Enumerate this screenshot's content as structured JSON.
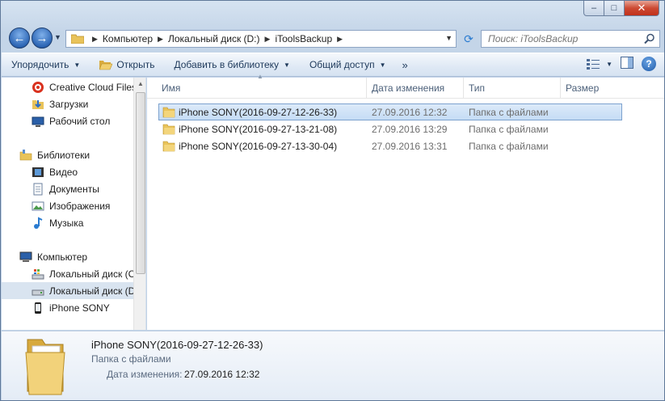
{
  "window": {
    "min_label": "‒",
    "max_label": "□",
    "close_label": "✕"
  },
  "address": {
    "crumbs": [
      "Компьютер",
      "Локальный диск (D:)",
      "iToolsBackup"
    ]
  },
  "search": {
    "placeholder": "Поиск: iToolsBackup"
  },
  "toolbar": {
    "organize": "Упорядочить",
    "open": "Открыть",
    "add_to_library": "Добавить в библиотеку",
    "share": "Общий доступ",
    "more": "»"
  },
  "nav": {
    "items": [
      {
        "label": "Creative Cloud Files",
        "icon": "creative-cloud-icon"
      },
      {
        "label": "Загрузки",
        "icon": "downloads-icon"
      },
      {
        "label": "Рабочий стол",
        "icon": "desktop-icon"
      },
      {
        "label": "Библиотеки",
        "icon": "libraries-icon"
      },
      {
        "label": "Видео",
        "icon": "video-icon"
      },
      {
        "label": "Документы",
        "icon": "documents-icon"
      },
      {
        "label": "Изображения",
        "icon": "pictures-icon"
      },
      {
        "label": "Музыка",
        "icon": "music-icon"
      },
      {
        "label": "Компьютер",
        "icon": "computer-icon"
      },
      {
        "label": "Локальный диск (C:)",
        "icon": "drive-c-icon"
      },
      {
        "label": "Локальный диск (D:)",
        "icon": "drive-d-icon",
        "selected": true
      },
      {
        "label": "iPhone SONY",
        "icon": "iphone-icon"
      }
    ]
  },
  "columns": {
    "name": "Имя",
    "date": "Дата изменения",
    "type": "Тип",
    "size": "Размер"
  },
  "files": [
    {
      "name": "iPhone SONY(2016-09-27-12-26-33)",
      "date": "27.09.2016 12:32",
      "type": "Папка с файлами",
      "selected": true
    },
    {
      "name": "iPhone SONY(2016-09-27-13-21-08)",
      "date": "27.09.2016 13:29",
      "type": "Папка с файлами"
    },
    {
      "name": "iPhone SONY(2016-09-27-13-30-04)",
      "date": "27.09.2016 13:31",
      "type": "Папка с файлами"
    }
  ],
  "details": {
    "name": "iPhone SONY(2016-09-27-12-26-33)",
    "type": "Папка с файлами",
    "date_label": "Дата изменения:",
    "date": "27.09.2016 12:32"
  }
}
